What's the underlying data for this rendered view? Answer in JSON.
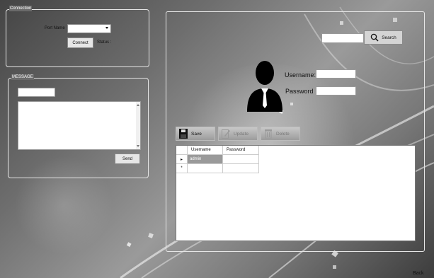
{
  "connection": {
    "title": "Connection",
    "port_label": "Port Name",
    "port_value": "",
    "connect_button": "Connect",
    "status_label": "Status :"
  },
  "message": {
    "title": "MESSAGE",
    "input_value": "",
    "text_value": "",
    "send_button": "Send"
  },
  "user_panel": {
    "search_value": "",
    "search_button": "Search",
    "username_label": "Username:",
    "password_label": "Password",
    "username_value": "",
    "password_value": "",
    "toolbar": {
      "save": "Save",
      "update": "Update",
      "delete": "Delete"
    },
    "grid": {
      "columns": [
        "Username",
        "Password"
      ],
      "rows": [
        {
          "marker": "▸",
          "username": "admin",
          "password": ""
        },
        {
          "marker": "*",
          "username": "",
          "password": ""
        }
      ]
    }
  },
  "footer": {
    "back_link": "Back"
  },
  "colors": {
    "selected_cell": "#9a9a9a",
    "group_border": "#e6e6e6"
  }
}
